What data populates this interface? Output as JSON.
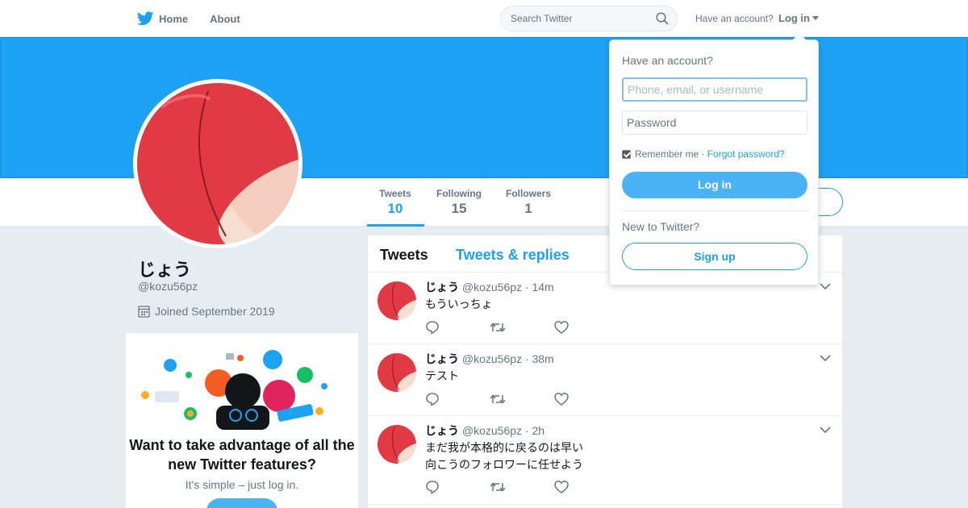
{
  "nav": {
    "home_label": "Home",
    "about_label": "About",
    "search_placeholder": "Search Twitter",
    "have_account": "Have an account?",
    "login_label": "Log in"
  },
  "profile": {
    "name": "じょう",
    "handle": "@kozu56pz",
    "joined": "Joined September 2019",
    "banner_color": "#1da1f2"
  },
  "stats": [
    {
      "label": "Tweets",
      "value": "10"
    },
    {
      "label": "Following",
      "value": "15"
    },
    {
      "label": "Followers",
      "value": "1"
    }
  ],
  "promo": {
    "title": "Want to take advantage of all the new Twitter features?",
    "subtitle": "It's simple – just log in."
  },
  "timeline": {
    "tabs": [
      "Tweets",
      "Tweets & replies"
    ],
    "tweets": [
      {
        "name": "じょう",
        "handle": "@kozu56pz",
        "time": "· 14m",
        "lines": [
          "もういっちょ"
        ]
      },
      {
        "name": "じょう",
        "handle": "@kozu56pz",
        "time": "· 38m",
        "lines": [
          "テスト"
        ]
      },
      {
        "name": "じょう",
        "handle": "@kozu56pz",
        "time": "· 2h",
        "lines": [
          "まだ我が本格的に戻るのは早い",
          "向こうのフォロワーに任せよう"
        ]
      }
    ]
  },
  "login_dropdown": {
    "title": "Have an account?",
    "username_placeholder": "Phone, email, or username",
    "password_placeholder": "Password",
    "remember_label": "Remember me",
    "forgot_label": "· Forgot password?",
    "login_button": "Log in",
    "new_label": "New to Twitter?",
    "signup_button": "Sign up"
  },
  "icons": {
    "logo": "twitter-bird-icon",
    "search": "search-icon",
    "calendar": "calendar-icon",
    "reply": "reply-icon",
    "retweet": "retweet-icon",
    "like": "heart-icon",
    "more": "chevron-down-icon"
  },
  "colors": {
    "accent": "#1da1f2",
    "button": "#4ab3f4"
  }
}
